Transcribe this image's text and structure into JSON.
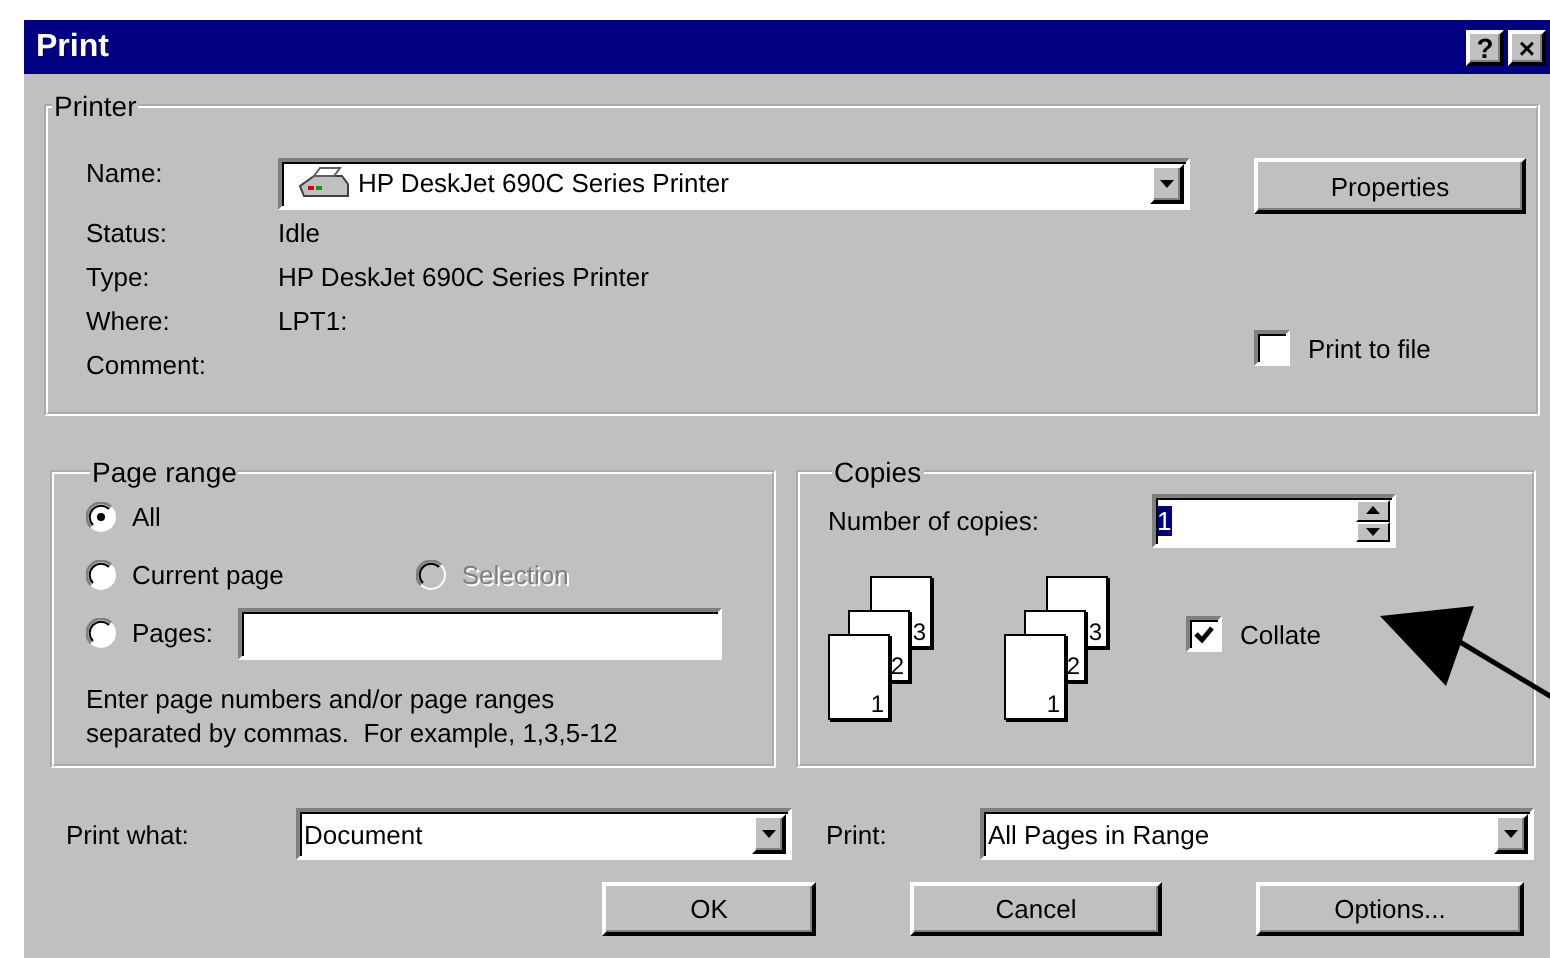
{
  "window": {
    "title": "Print",
    "title_buttons": [
      "?",
      "×"
    ]
  },
  "printer": {
    "label": "Printer",
    "name_label": "Name:",
    "name_value": "HP DeskJet 690C Series Printer",
    "properties_button": "Properties",
    "info": [
      {
        "label": "Status:",
        "value": "Idle"
      },
      {
        "label": "Type:",
        "value": "HP DeskJet 690C Series Printer"
      },
      {
        "label": "Where:",
        "value": "LPT1:"
      },
      {
        "label": "Comment:"
      }
    ],
    "print_to_file": {
      "label": "Print to file",
      "checked": false
    }
  },
  "page_range": {
    "label": "Page range",
    "rows": [
      {
        "options": [
          {
            "kind": "radio",
            "label": "All",
            "selected": true,
            "disabled": false
          }
        ]
      },
      {
        "options": [
          {
            "kind": "radio",
            "label": "Current page",
            "selected": false,
            "disabled": false
          },
          {
            "kind": "radio",
            "label": "Selection",
            "selected": false,
            "disabled": true
          }
        ]
      },
      {
        "options": [
          {
            "kind": "radio_field",
            "label": "Pages:",
            "selected": false,
            "disabled": false
          }
        ]
      }
    ],
    "hint_lines": [
      "Enter page numbers and/or page ranges",
      "separated by commas.  For example, 1,3,5-12"
    ]
  },
  "copies": {
    "label": "Copies",
    "number_label": "Number of copies:",
    "number_value": "1",
    "number_selected": true,
    "stacks": [
      {
        "pages": [
          "1",
          "2",
          "3"
        ]
      },
      {
        "pages": [
          "1",
          "2",
          "3"
        ]
      }
    ],
    "collate": {
      "label": "Collate",
      "checked": true
    }
  },
  "print_what": {
    "label": "Print what:",
    "value": "Document"
  },
  "print": {
    "label": "Print:",
    "value": "All Pages in Range"
  },
  "buttons": [
    "OK",
    "Cancel",
    "Options..."
  ]
}
